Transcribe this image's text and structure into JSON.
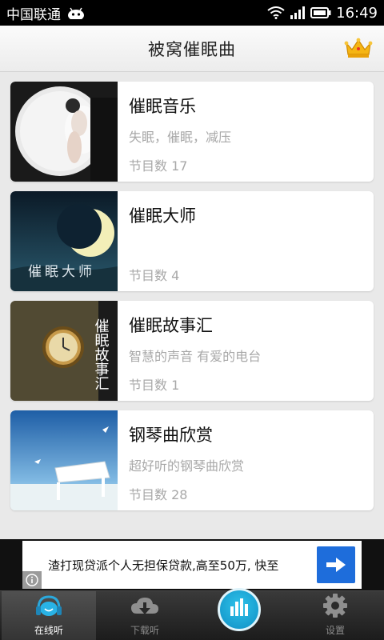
{
  "status_bar": {
    "carrier": "中国联通",
    "time": "16:49"
  },
  "header": {
    "title": "被窝催眠曲",
    "crown_icon": "crown-icon"
  },
  "programs": [
    {
      "title": "催眠音乐",
      "subtitle": "失眠，催眠，减压",
      "count": "节目数 17"
    },
    {
      "title": "催眠大师",
      "subtitle": "",
      "count": "节目数 4",
      "thumb_caption": "催眠大师"
    },
    {
      "title": "催眠故事汇",
      "subtitle": "智慧的声音 有爱的电台",
      "count": "节目数 1",
      "thumb_caption": "催眠故事汇"
    },
    {
      "title": "钢琴曲欣赏",
      "subtitle": "超好听的钢琴曲欣赏",
      "count": "节目数 28"
    }
  ],
  "ad": {
    "text": "渣打现贷派个人无担保贷款,高至50万, 快至",
    "button_icon": "arrow-right-icon",
    "info_icon": "info-icon"
  },
  "bottom_nav": {
    "items": [
      {
        "label": "在线听",
        "icon": "headphones-icon",
        "active": true
      },
      {
        "label": "下载听",
        "icon": "download-icon",
        "active": false
      },
      {
        "label": "",
        "icon": "equalizer-icon",
        "active": false
      },
      {
        "label": "设置",
        "icon": "gear-icon",
        "active": false
      }
    ]
  },
  "colors": {
    "accent_blue": "#1e9fd6",
    "ad_button": "#1e6ddb"
  }
}
